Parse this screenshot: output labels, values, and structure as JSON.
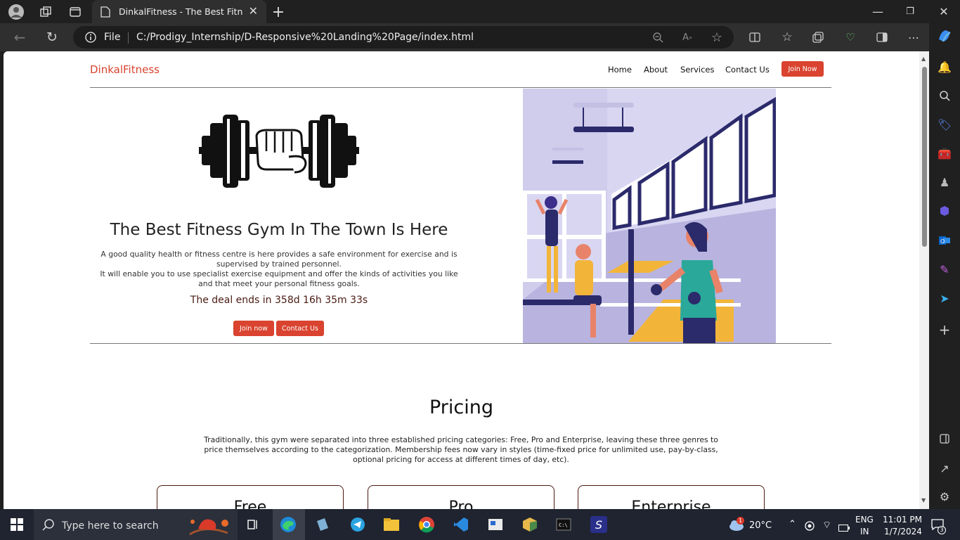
{
  "browser": {
    "tab_title": "DinkalFitness - The Best Fitness G",
    "address_file_label": "File",
    "url": "C:/Prodigy_Internship/D-Responsive%20Landing%20Page/index.html"
  },
  "site": {
    "brand": "DinkalFitness",
    "nav": [
      "Home",
      "About",
      "Services",
      "Contact Us"
    ],
    "nav_cta": "Join Now",
    "hero": {
      "title": "The Best Fitness Gym In The Town Is Here",
      "line1": "A good quality health or fitness centre is here provides a safe environment for exercise and is supervised by trained personnel.",
      "line2": "It will enable you to use specialist exercise equipment and offer the kinds of activities you like and that meet your personal fitness goals.",
      "deal": "The deal ends in 358d 16h 35m 33s",
      "btn_join": "Join now",
      "btn_contact": "Contact Us"
    },
    "pricing": {
      "title": "Pricing",
      "text": "Traditionally, this gym were separated into three established pricing categories: Free, Pro and Enterprise, leaving these three genres to price themselves according to the categorization. Membership fees now vary in styles (time-fixed price for unlimited use, pay-by-class, optional pricing for access at different times of day, etc).",
      "cards": [
        "Free",
        "Pro",
        "Enterprise"
      ]
    }
  },
  "taskbar": {
    "search_placeholder": "Type here to search",
    "weather": "20°C",
    "weather_badge": "1",
    "lang1": "ENG",
    "lang2": "IN",
    "time": "11:01 PM",
    "date": "1/7/2024",
    "notif_count": "3"
  },
  "colors": {
    "accent": "#d9432f",
    "hero_bg": "#c9c6e8",
    "hero_dark": "#2b2a6b"
  }
}
